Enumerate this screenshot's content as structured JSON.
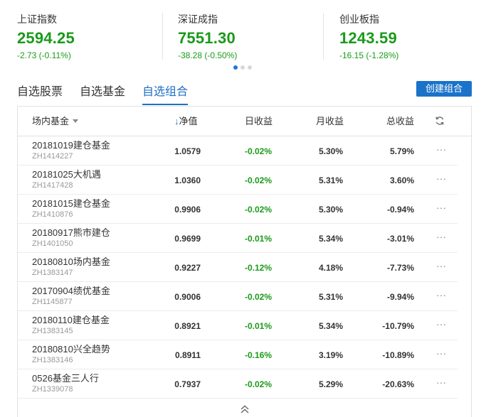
{
  "indices": [
    {
      "name": "上证指数",
      "value": "2594.25",
      "change": "-2.73 (-0.11%)"
    },
    {
      "name": "深证成指",
      "value": "7551.30",
      "change": "-38.28 (-0.50%)"
    },
    {
      "name": "创业板指",
      "value": "1243.59",
      "change": "-16.15 (-1.28%)"
    }
  ],
  "tabs": [
    {
      "label": "自选股票",
      "active": false
    },
    {
      "label": "自选基金",
      "active": false
    },
    {
      "label": "自选组合",
      "active": true
    }
  ],
  "create_button": "创建组合",
  "table": {
    "headers": {
      "fund": "场内基金",
      "nav_arrow": "↓",
      "nav": "净值",
      "daily": "日收益",
      "monthly": "月收益",
      "total": "总收益"
    },
    "rows": [
      {
        "name": "20181019建仓基金",
        "code": "ZH1414227",
        "nav": "1.0579",
        "daily": "-0.02%",
        "monthly": "5.30%",
        "total": "5.79%"
      },
      {
        "name": "20181025大机遇",
        "code": "ZH1417428",
        "nav": "1.0360",
        "daily": "-0.02%",
        "monthly": "5.31%",
        "total": "3.60%"
      },
      {
        "name": "20181015建仓基金",
        "code": "ZH1410876",
        "nav": "0.9906",
        "daily": "-0.02%",
        "monthly": "5.30%",
        "total": "-0.94%"
      },
      {
        "name": "20180917熊市建仓",
        "code": "ZH1401050",
        "nav": "0.9699",
        "daily": "-0.01%",
        "monthly": "5.34%",
        "total": "-3.01%"
      },
      {
        "name": "20180810场内基金",
        "code": "ZH1383147",
        "nav": "0.9227",
        "daily": "-0.12%",
        "monthly": "4.18%",
        "total": "-7.73%"
      },
      {
        "name": "20170904绩优基金",
        "code": "ZH1145877",
        "nav": "0.9006",
        "daily": "-0.02%",
        "monthly": "5.31%",
        "total": "-9.94%"
      },
      {
        "name": "20180110建仓基金",
        "code": "ZH1383145",
        "nav": "0.8921",
        "daily": "-0.01%",
        "monthly": "5.34%",
        "total": "-10.79%"
      },
      {
        "name": "20180810兴全趋势",
        "code": "ZH1383146",
        "nav": "0.8911",
        "daily": "-0.16%",
        "monthly": "3.19%",
        "total": "-10.89%"
      },
      {
        "name": "0526基金三人行",
        "code": "ZH1339078",
        "nav": "0.7937",
        "daily": "-0.02%",
        "monthly": "5.29%",
        "total": "-20.63%"
      }
    ],
    "more_label": "···"
  },
  "icons": {
    "refresh": "refresh-icon",
    "more": "more-dots-icon",
    "collapse": "chevron-double-up-icon",
    "sort_caret": "caret-down-icon"
  },
  "colors": {
    "down_green": "#1a9a1a",
    "accent_blue": "#1f6fc4",
    "button_blue": "#1a73c9"
  }
}
